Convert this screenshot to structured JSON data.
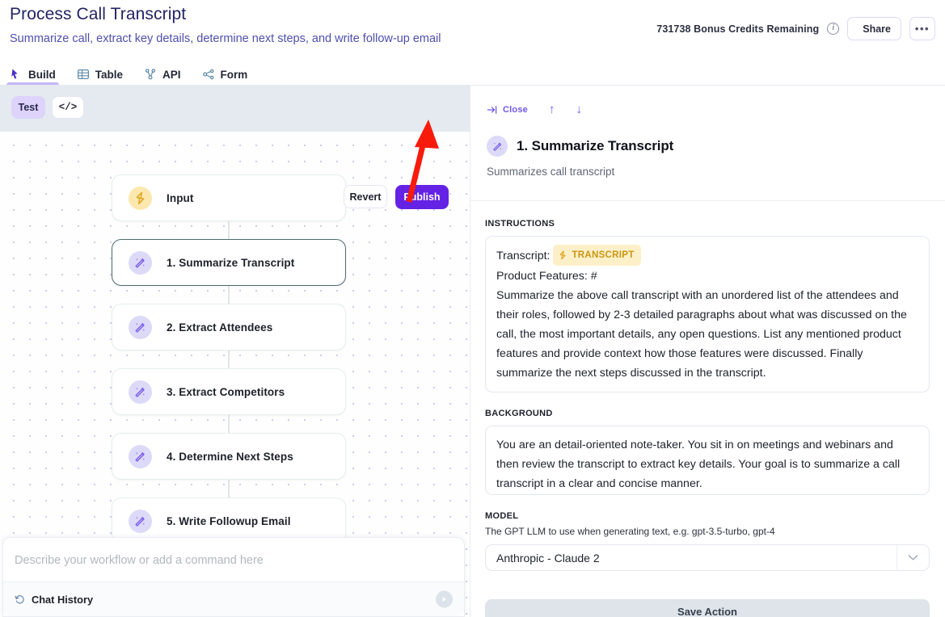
{
  "header": {
    "title": "Process Call Transcript",
    "subtitle": "Summarize call, extract key details, determine next steps, and write follow-up email",
    "credits": "731738 Bonus Credits Remaining",
    "info_icon": "info-icon",
    "share_label": "Share",
    "share_icon": "share-nodes-icon",
    "more_label": "•••",
    "accent_purple": "#6422e4",
    "title_color": "#232463",
    "subtitle_color": "#4f4fb0"
  },
  "tabs": [
    {
      "label": "Build",
      "icon": "build-cursor-icon",
      "active": true
    },
    {
      "label": "Table",
      "icon": "table-grid-icon",
      "active": false
    },
    {
      "label": "API",
      "icon": "api-nodes-icon",
      "active": false
    },
    {
      "label": "Form",
      "icon": "form-nodes-icon",
      "active": false
    }
  ],
  "toolbar": {
    "test_label": "Test",
    "code_label": "</>",
    "revert_label": "Revert",
    "publish_label": "Publish",
    "background": "#e4eaf0"
  },
  "annotation": {
    "type": "red-arrow",
    "color": "#f81b0b",
    "points_to": "publish-button"
  },
  "canvas": {
    "nodes": [
      {
        "label": "Input",
        "icon": "lightning-bolt-icon",
        "kind": "input",
        "selected": false
      },
      {
        "label": "1. Summarize Transcript",
        "icon": "magic-wand-icon",
        "kind": "step",
        "selected": true
      },
      {
        "label": "2. Extract Attendees",
        "icon": "magic-wand-icon",
        "kind": "step",
        "selected": false
      },
      {
        "label": "3. Extract Competitors",
        "icon": "magic-wand-icon",
        "kind": "step",
        "selected": false
      },
      {
        "label": "4. Determine Next Steps",
        "icon": "magic-wand-icon",
        "kind": "step",
        "selected": false
      },
      {
        "label": "5. Write Followup Email",
        "icon": "magic-wand-icon",
        "kind": "step",
        "selected": false
      }
    ]
  },
  "chat": {
    "placeholder": "Describe your workflow or add a command here",
    "value": "",
    "history_label": "Chat History",
    "history_icon": "history-clock-icon",
    "send_icon": "send-play-icon"
  },
  "panel": {
    "close_label": "Close",
    "close_icon": "collapse-right-icon",
    "up_icon": "arrow-up-icon",
    "down_icon": "arrow-down-icon",
    "step_icon": "magic-wand-icon",
    "title": "1. Summarize Transcript",
    "subtitle": "Summarizes call transcript",
    "instructions_label": "INSTRUCTIONS",
    "instructions": {
      "line1_prefix": "Transcript: ",
      "chip_label": "TRANSCRIPT",
      "chip_icon": "lightning-bolt-icon",
      "line2": "Product Features: #",
      "body": "Summarize the above call transcript with an unordered list of the attendees and their roles, followed by 2-3 detailed paragraphs about what was discussed on the call, the most important details, any open questions.  List any mentioned product features and provide context how those features were discussed. Finally summarize the next steps discussed in the transcript."
    },
    "background_label": "BACKGROUND",
    "background_text": "You are an detail-oriented note-taker. You sit in on meetings and webinars and then review the transcript to extract key details. Your goal is to summarize a call transcript in a clear and concise manner.",
    "model_label": "MODEL",
    "model_help": "The GPT LLM to use when generating text, e.g. gpt-3.5-turbo, gpt-4",
    "model_value": "Anthropic - Claude 2",
    "model_caret": "chevron-down-icon",
    "save_label": "Save Action"
  }
}
